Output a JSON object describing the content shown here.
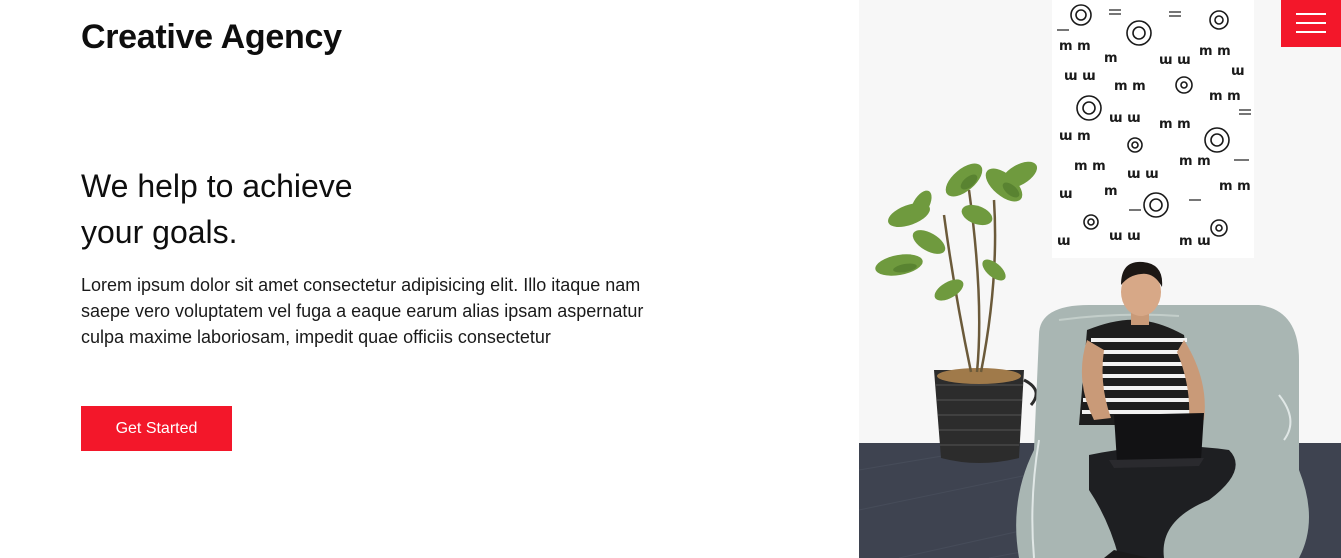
{
  "header": {
    "brand": "Creative Agency",
    "menu_icon": "hamburger-menu-icon"
  },
  "hero": {
    "title_line1": "We help to achieve",
    "title_line2": "your goals.",
    "body": "Lorem ipsum dolor sit amet consectetur adipisicing elit. Illo itaque nam saepe vero voluptatem vel fuga a eaque earum alias ipsam aspernatur culpa maxime laboriosam, impedit quae officiis consectetur",
    "cta_label": "Get Started",
    "image_icon": "man-with-laptop-photo"
  },
  "colors": {
    "accent": "#f3172a",
    "text": "#0e0e0e",
    "background": "#ffffff"
  }
}
